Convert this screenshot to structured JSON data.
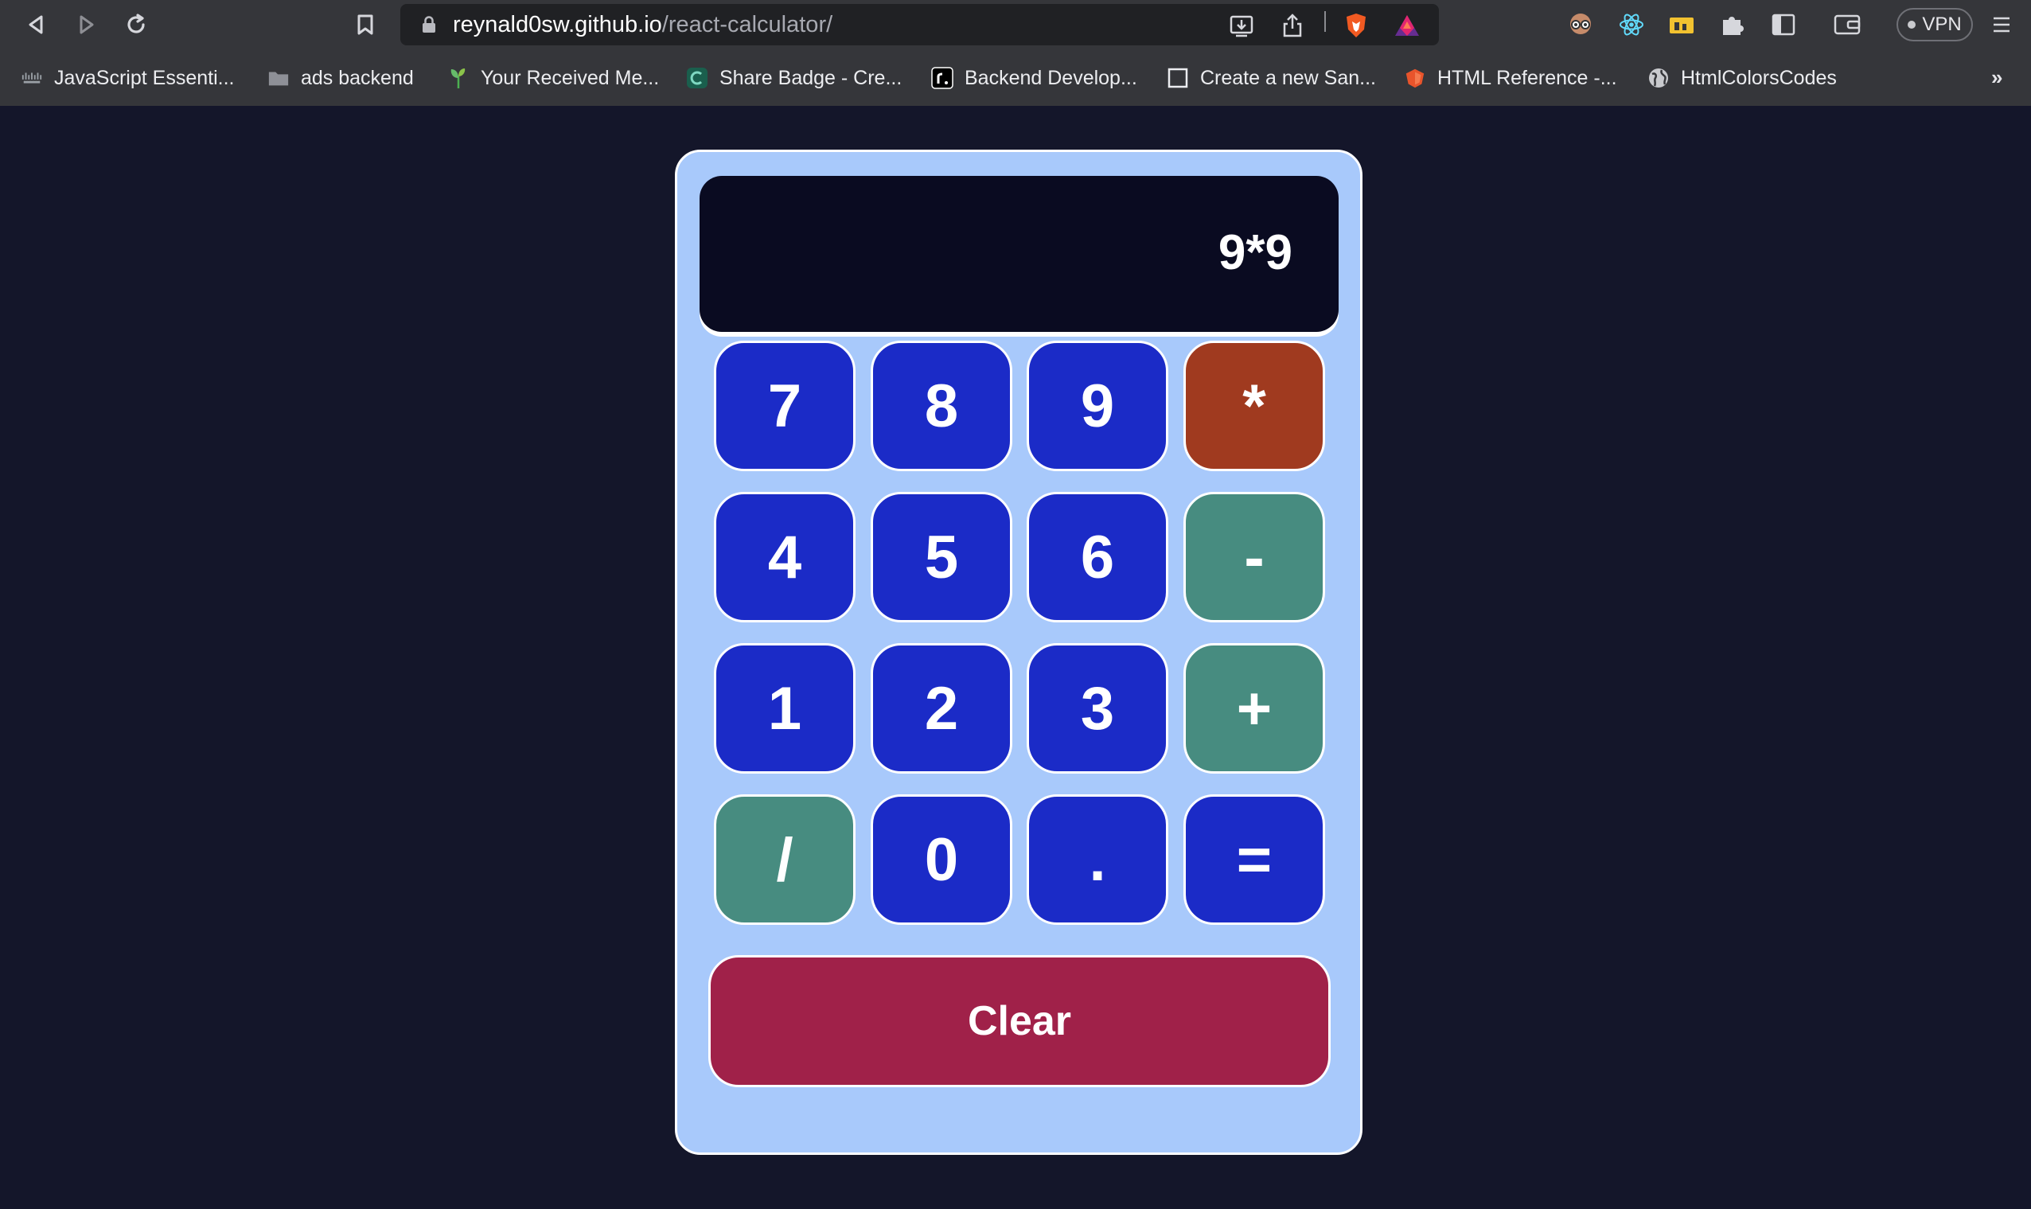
{
  "browser": {
    "url_host": "reynald0sw.github.io",
    "url_path": "/react-calculator/",
    "vpn_label": "VPN",
    "bookmarks_overflow": "»",
    "bookmarks": [
      {
        "label": "JavaScript Essenti...",
        "icon": "cisco-icon"
      },
      {
        "label": "ads backend",
        "icon": "folder-icon"
      },
      {
        "label": "Your Received Me...",
        "icon": "plant-icon"
      },
      {
        "label": "Share Badge - Cre...",
        "icon": "credly-icon"
      },
      {
        "label": "Backend Develop...",
        "icon": "roadmap-icon"
      },
      {
        "label": "Create a new San...",
        "icon": "square-icon"
      },
      {
        "label": "HTML Reference -...",
        "icon": "html-icon"
      },
      {
        "label": "HtmlColorsCodes",
        "icon": "globe-icon"
      }
    ]
  },
  "calculator": {
    "display": "9*9",
    "keys": [
      {
        "label": "7",
        "kind": "num"
      },
      {
        "label": "8",
        "kind": "num"
      },
      {
        "label": "9",
        "kind": "num"
      },
      {
        "label": "*",
        "kind": "op-red"
      },
      {
        "label": "4",
        "kind": "num"
      },
      {
        "label": "5",
        "kind": "num"
      },
      {
        "label": "6",
        "kind": "num"
      },
      {
        "label": "-",
        "kind": "op-teal"
      },
      {
        "label": "1",
        "kind": "num"
      },
      {
        "label": "2",
        "kind": "num"
      },
      {
        "label": "3",
        "kind": "num"
      },
      {
        "label": "+",
        "kind": "op-teal"
      },
      {
        "label": "/",
        "kind": "op-teal"
      },
      {
        "label": "0",
        "kind": "num"
      },
      {
        "label": ".",
        "kind": "num"
      },
      {
        "label": "=",
        "kind": "eq"
      }
    ],
    "clear_label": "Clear"
  },
  "colors": {
    "page_bg": "#14162a",
    "calc_bg": "#a8c9fb",
    "display_bg": "#0a0b21",
    "num_key": "#1b2bc7",
    "op_teal": "#478c80",
    "op_red": "#a03a1f",
    "clear": "#a02149"
  }
}
